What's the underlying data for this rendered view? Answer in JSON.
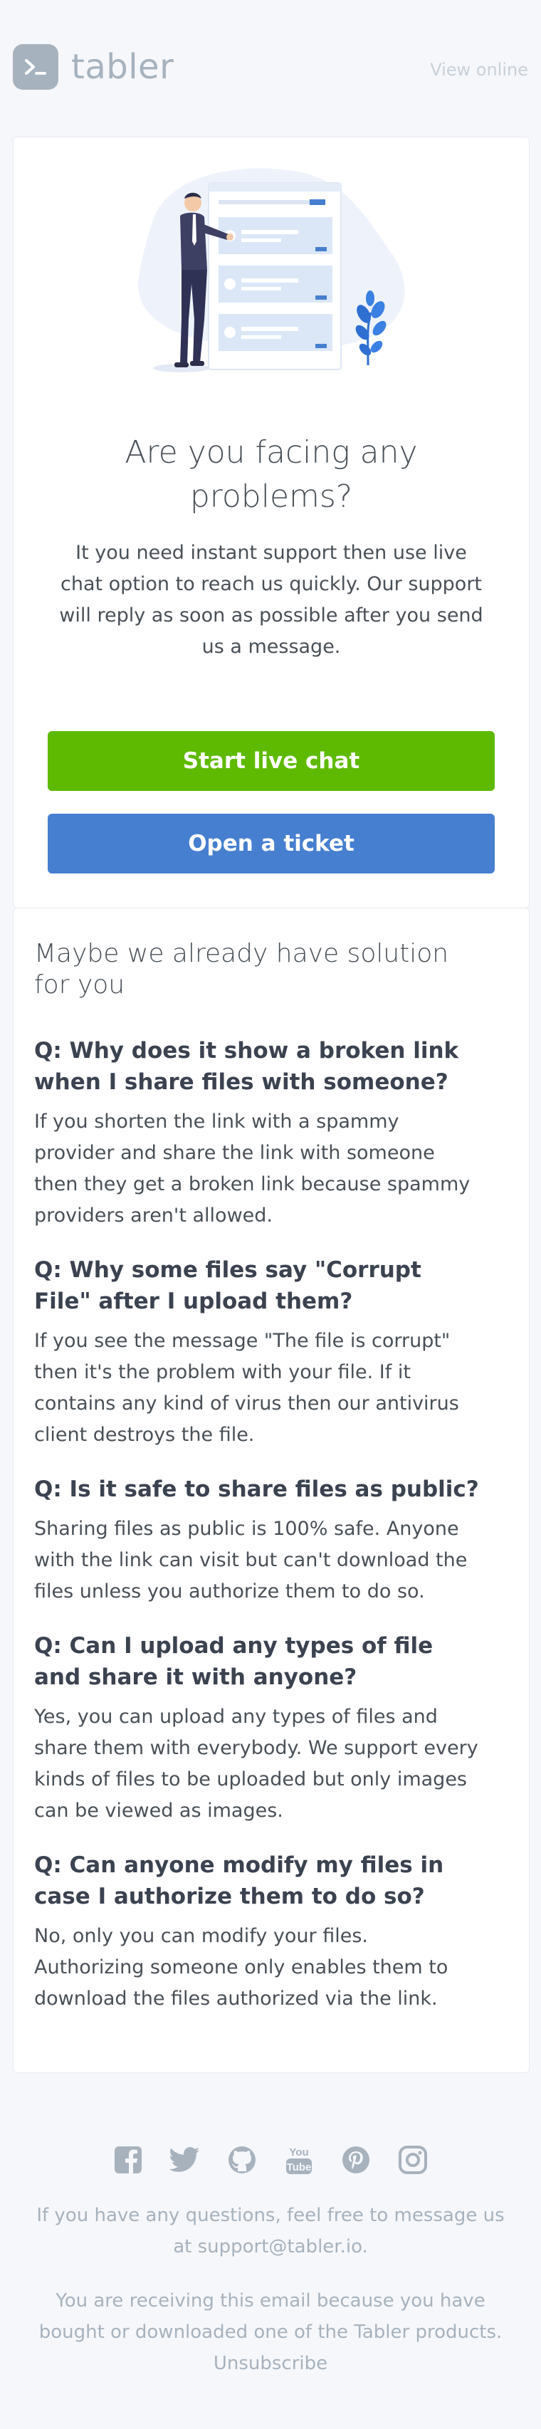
{
  "header": {
    "brand": "tabler",
    "view_online": "View online"
  },
  "hero": {
    "title": "Are you facing any problems?",
    "lead": "It you need instant support then use live chat option to reach us quickly. Our support will reply as soon as possible after you send us a message.",
    "primary_button": "Start live chat",
    "secondary_button": "Open a ticket"
  },
  "faq": {
    "title": "Maybe we already have solution for you",
    "items": [
      {
        "q": "Q: Why does it show a broken link when I share files with someone?",
        "a": "If you shorten the link with a spammy provider and share the link with someone then they get a broken link because spammy providers aren't allowed."
      },
      {
        "q": "Q: Why some files say \"Corrupt File\" after I upload them?",
        "a": "If you see the message \"The file is corrupt\" then it's the problem with your file. If it contains any kind of virus then our antivirus client destroys the file."
      },
      {
        "q": "Q: Is it safe to share files as public?",
        "a": "Sharing files as public is 100% safe. Anyone with the link can visit but can't download the files unless you authorize them to do so."
      },
      {
        "q": "Q: Can I upload any types of file and share it with anyone?",
        "a": "Yes, you can upload any types of files and share them with everybody. We support every kinds of files to be uploaded but only images can be viewed as images."
      },
      {
        "q": "Q: Can anyone modify my files in case I authorize them to do so?",
        "a": "No, only you can modify your files. Authorizing someone only enables them to download the files authorized via the link."
      }
    ]
  },
  "footer": {
    "social_icons": [
      "facebook-icon",
      "twitter-icon",
      "github-icon",
      "youtube-icon",
      "pinterest-icon",
      "instagram-icon"
    ],
    "youtube_word_top": "You",
    "youtube_word_bottom": "Tube",
    "questions_text": "If you have any questions, feel free to message us at",
    "support_email": "support@tabler.io.",
    "receiving_text": "You are receiving this email because you have bought or downloaded one of the Tabler products.",
    "unsubscribe": "Unsubscribe"
  },
  "colors": {
    "background": "#f5f7fb",
    "green": "#5eba00",
    "blue": "#467fcf",
    "muted": "#a7b2bd"
  }
}
